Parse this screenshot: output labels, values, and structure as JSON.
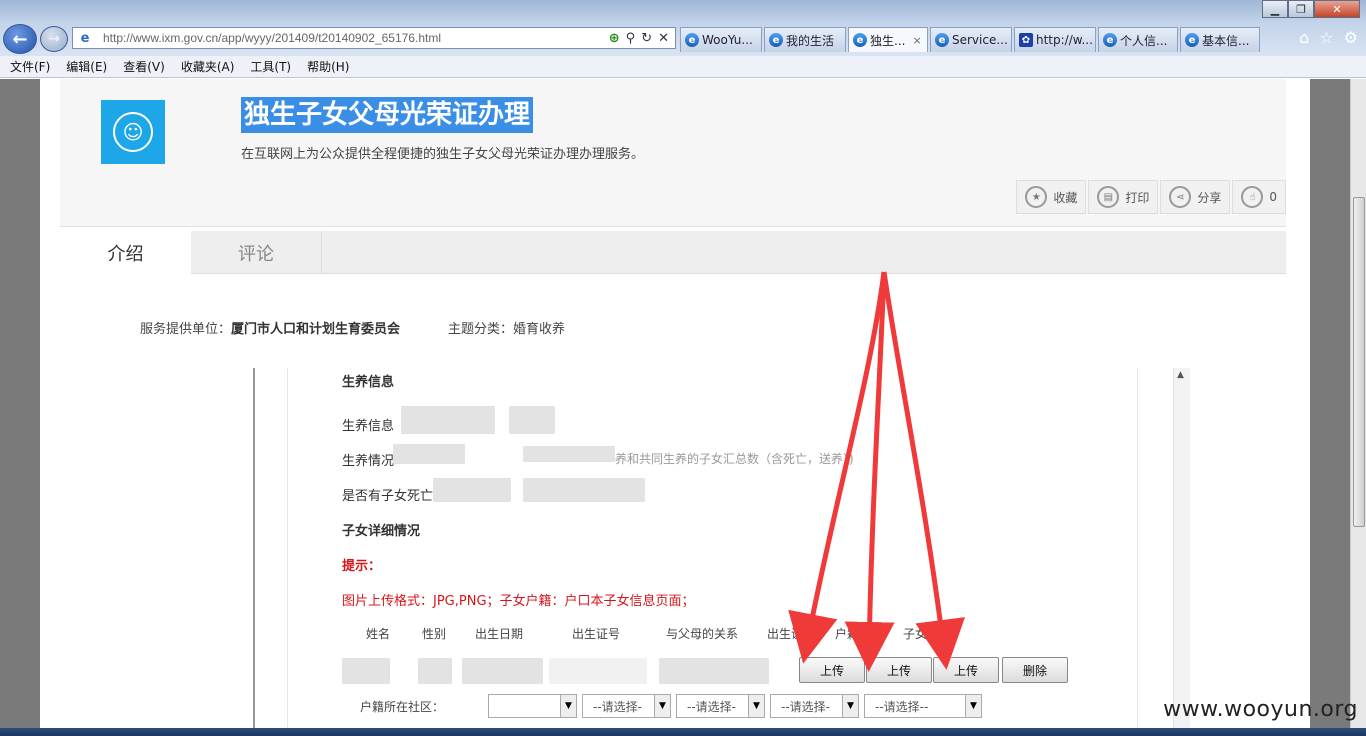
{
  "browser": {
    "address_url": "http://www.ixm.gov.cn/app/wyyy/201409/t20140902_65176.html",
    "tabs": [
      {
        "label": "WooYu...",
        "active": false
      },
      {
        "label": "我的生活",
        "active": false
      },
      {
        "label": "独生...",
        "active": true
      },
      {
        "label": "Service...",
        "active": false
      },
      {
        "label": "http://w...",
        "active": false
      },
      {
        "label": "个人信...",
        "active": false
      },
      {
        "label": "基本信...",
        "active": false
      }
    ],
    "close_glyph": "×",
    "menu": [
      "文件(F)",
      "编辑(E)",
      "查看(V)",
      "收藏夹(A)",
      "工具(T)",
      "帮助(H)"
    ]
  },
  "header": {
    "title": "独生子女父母光荣证办理",
    "description": "在互联网上为公众提供全程便捷的独生子女父母光荣证办理办理服务。",
    "actions": [
      {
        "label": "收藏",
        "icon": "star-icon"
      },
      {
        "label": "打印",
        "icon": "print-icon"
      },
      {
        "label": "分享",
        "icon": "share-icon"
      },
      {
        "label": "0",
        "icon": "thumbs-up-icon"
      }
    ]
  },
  "page_tabs": {
    "intro": "介绍",
    "comments": "评论"
  },
  "meta": {
    "provider_label": "服务提供单位：",
    "provider_value": "厦门市人口和计划生育委员会",
    "topic_label": "主题分类：",
    "topic_value": "婚育收养"
  },
  "form": {
    "section_title": "生养信息",
    "field1_label": "生养信息",
    "field2_label": "生养情况",
    "field2_hint": "养和共同生养的子女汇总数（含死亡，送养）)",
    "field3_label": "是否有子女死亡",
    "children_title": "子女详细情况",
    "tip_label": "提示：",
    "tip_text": "图片上传格式：JPG,PNG；子女户籍：户口本子女信息页面；",
    "columns": [
      "姓名",
      "性别",
      "出生日期",
      "出生证号",
      "与父母的关系",
      "出生证明",
      "户籍首页",
      "子女户籍"
    ],
    "buttons": {
      "upload": "上传",
      "delete": "删除"
    },
    "hukou_label": "户籍所在社区：",
    "select_placeholder": "--请选择--",
    "select_placeholder_short": "--请选择-"
  },
  "watermark": "www.wooyun.org",
  "colors": {
    "accent_blue": "#1ea7e8",
    "tip_red": "#d8141b",
    "arrow_red": "#f03a3a"
  }
}
